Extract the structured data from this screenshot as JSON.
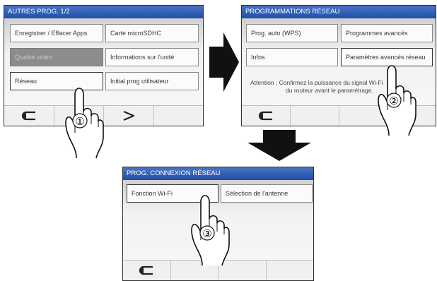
{
  "screen1": {
    "title": "AUTRES PROG. 1/2",
    "buttons": [
      {
        "label": "Enregistrer / Effacer Apps"
      },
      {
        "label": "Carte microSDHC"
      },
      {
        "label": "Qualité vidéo"
      },
      {
        "label": "Informations sur l'unité"
      },
      {
        "label": "Réseau"
      },
      {
        "label": "Initial.prog utilisateur"
      }
    ],
    "footer_icons": [
      "back-arrow-icon",
      "next-arrow-icon"
    ]
  },
  "screen2": {
    "title": "PROGRAMMATIONS RÉSEAU",
    "buttons": [
      {
        "label": "Prog. auto (WPS)"
      },
      {
        "label": "Programmes avancés"
      },
      {
        "label": "Infos"
      },
      {
        "label": "Paramètres avancés réseau"
      }
    ],
    "notice_line1": "Attention : Confirmez la puissance du signal Wi-Fi",
    "notice_line2": "du routeur avant le paramétrage.",
    "footer_icons": [
      "back-arrow-icon"
    ]
  },
  "screen3": {
    "title": "PROG. CONNEXION RÉSEAU",
    "buttons": [
      {
        "label": "Fonction Wi-Fi"
      },
      {
        "label": "Sélection de l'antenne"
      }
    ],
    "footer_icons": [
      "back-arrow-icon"
    ]
  },
  "steps": [
    "①",
    "②",
    "③"
  ],
  "colors": {
    "titlebar": "#2b5bb5",
    "disabled_button": "#8c8c8c",
    "arrow": "#111111"
  }
}
